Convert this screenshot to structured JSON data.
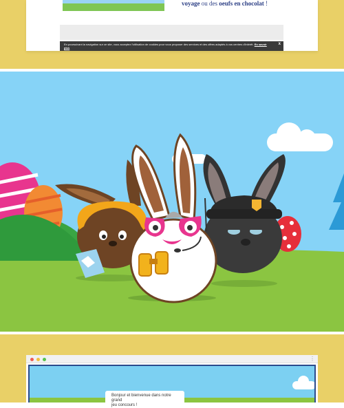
{
  "top": {
    "text_prefix": "voyage",
    "text_middle": " ou des ",
    "text_bold": "oeufs en chocolat",
    "text_suffix": " !"
  },
  "cookie": {
    "text": "En poursuivant la navigation sur ce site, vous acceptez l'utilisation de cookies pour vous proposer des services et des offres adaptés à vos centres d'intérêt.",
    "link": "En savoir plus",
    "close": "x"
  },
  "bottom": {
    "greeting_line1": "Bonjour et bienvenue dans notre grand",
    "greeting_line2": "jeu concours !",
    "window_menu": "⋮"
  },
  "colors": {
    "band": "#e9d067",
    "sky": "#86d3f7",
    "grass": "#8bc541",
    "navy": "#2a3d84"
  }
}
